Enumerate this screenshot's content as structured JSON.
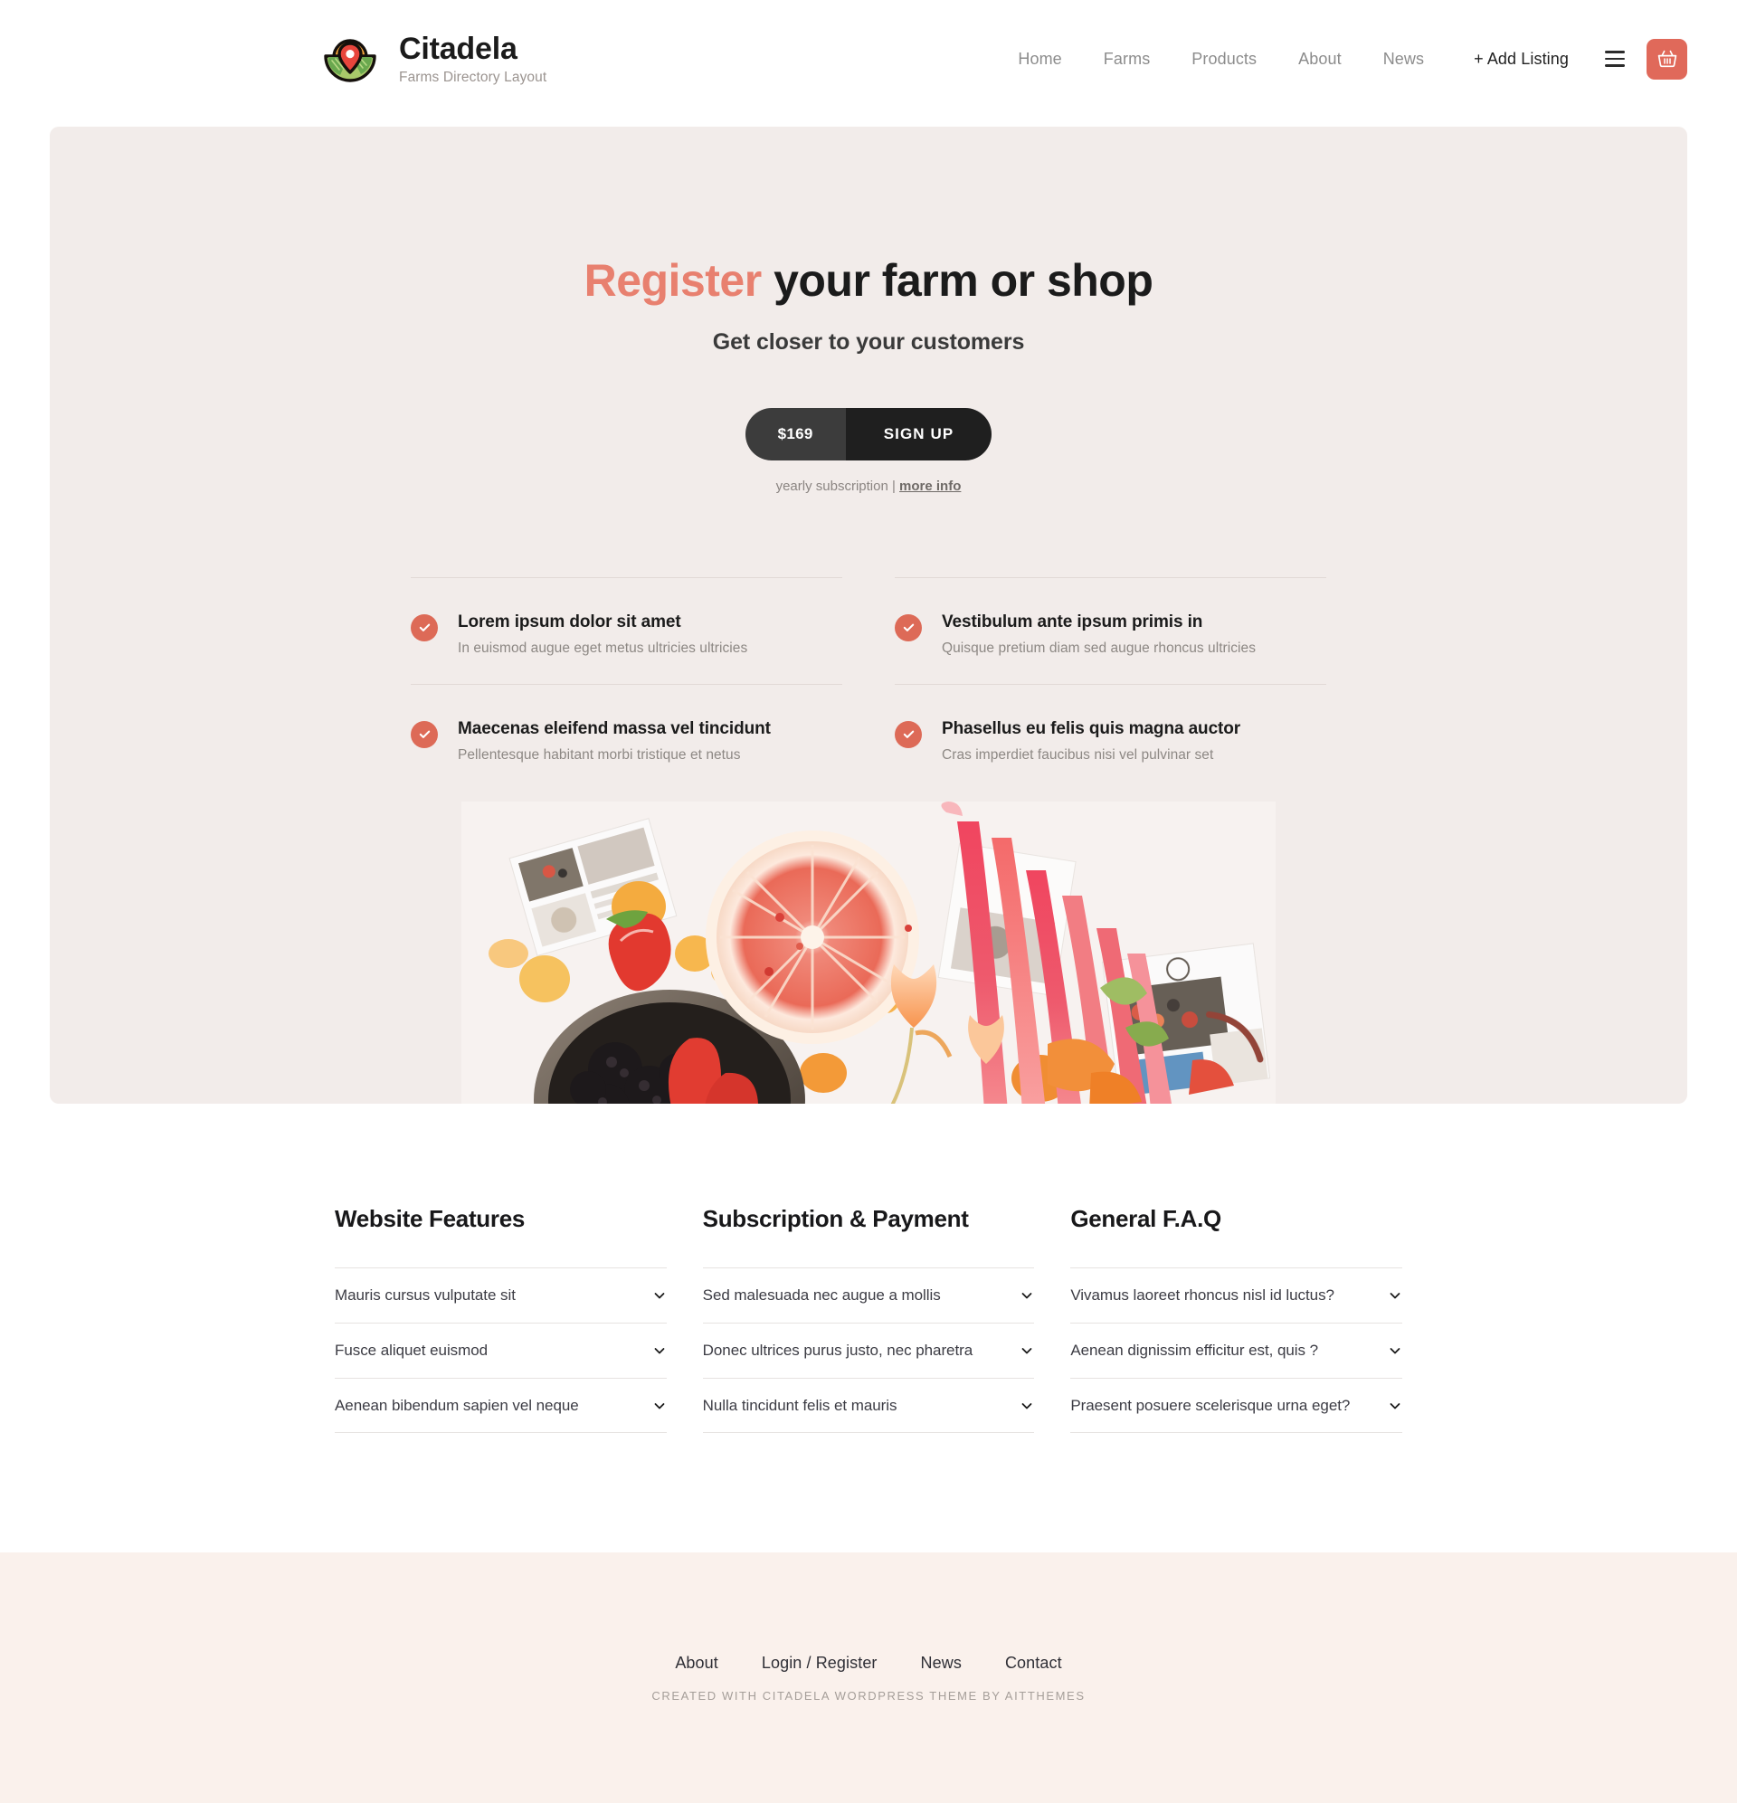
{
  "header": {
    "brand": {
      "title": "Citadela",
      "subtitle": "Farms Directory Layout",
      "logo_icon": "farm-pin-logo-icon"
    },
    "nav": [
      {
        "label": "Home"
      },
      {
        "label": "Farms"
      },
      {
        "label": "Products"
      },
      {
        "label": "About"
      },
      {
        "label": "News"
      },
      {
        "label": "+ Add Listing"
      }
    ],
    "menu_icon": "hamburger-menu-icon",
    "cart_icon": "shopping-basket-icon",
    "cart_color": "#e0695a"
  },
  "hero": {
    "title_accent": "Register",
    "title_rest": " your farm or shop",
    "subtitle": "Get closer to your customers",
    "price": "$169",
    "cta": "SIGN UP",
    "note_text": "yearly subscription | ",
    "note_link": "more info",
    "background": "#f2ecea",
    "accent_color": "#e8806f",
    "photo_alt": "flat-lay photo of strawberries, blackberries, blood orange slice, rhubarb stalks and oranges",
    "features": [
      {
        "title": "Lorem ipsum dolor sit amet",
        "desc": "In euismod augue eget metus ultricies ultricies",
        "icon": "check-circle-icon"
      },
      {
        "title": "Vestibulum ante ipsum primis in",
        "desc": "Quisque pretium diam sed augue rhoncus ultricies",
        "icon": "check-circle-icon"
      },
      {
        "title": "Maecenas eleifend massa vel tincidunt",
        "desc": "Pellentesque habitant morbi tristique et netus",
        "icon": "check-circle-icon"
      },
      {
        "title": "Phasellus eu felis quis magna auctor",
        "desc": "Cras imperdiet faucibus nisi vel pulvinar set",
        "icon": "check-circle-icon"
      }
    ]
  },
  "accordions": [
    {
      "title": "Website Features",
      "items": [
        {
          "label": "Mauris cursus vulputate sit"
        },
        {
          "label": "Fusce aliquet euismod"
        },
        {
          "label": "Aenean bibendum sapien vel neque"
        }
      ]
    },
    {
      "title": "Subscription & Payment",
      "items": [
        {
          "label": "Sed malesuada nec augue a mollis"
        },
        {
          "label": "Donec ultrices purus justo, nec pharetra"
        },
        {
          "label": "Nulla tincidunt felis et mauris"
        }
      ]
    },
    {
      "title": "General F.A.Q",
      "items": [
        {
          "label": "Vivamus laoreet rhoncus nisl id luctus?"
        },
        {
          "label": "Aenean dignissim efficitur est, quis ?"
        },
        {
          "label": "Praesent posuere scelerisque urna eget?"
        }
      ]
    }
  ],
  "footer": {
    "nav": [
      {
        "label": "About"
      },
      {
        "label": "Login / Register"
      },
      {
        "label": "News"
      },
      {
        "label": "Contact"
      }
    ],
    "credit": "Created with Citadela WordPress theme by AitThemes",
    "background": "#faf1ec"
  }
}
